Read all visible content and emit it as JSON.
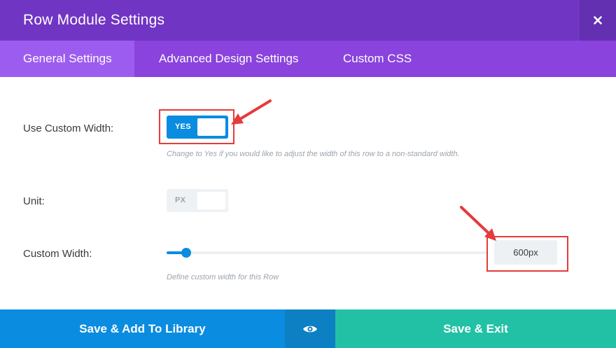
{
  "modal": {
    "title": "Row Module Settings",
    "close_icon": "close-icon"
  },
  "tabs": [
    {
      "label": "General Settings",
      "active": true
    },
    {
      "label": "Advanced Design Settings",
      "active": false
    },
    {
      "label": "Custom CSS",
      "active": false
    }
  ],
  "settings": {
    "custom_width_toggle": {
      "label": "Use Custom Width:",
      "state": "YES",
      "description": "Change to Yes if you would like to adjust the width of this row to a non-standard width."
    },
    "unit": {
      "label": "Unit:",
      "state": "PX"
    },
    "custom_width": {
      "label": "Custom Width:",
      "value": "600px",
      "slider_level": 0.06,
      "description": "Define custom width for this Row"
    }
  },
  "footer": {
    "save_library_label": "Save & Add To Library",
    "preview_icon": "eye-icon",
    "save_exit_label": "Save & Exit"
  },
  "colors": {
    "header_purple": "#7135c3",
    "tab_purple": "#8a43dd",
    "accent_blue": "#0a8ce0",
    "save_green": "#22c1a6",
    "annotation_red": "#e53b3b"
  }
}
